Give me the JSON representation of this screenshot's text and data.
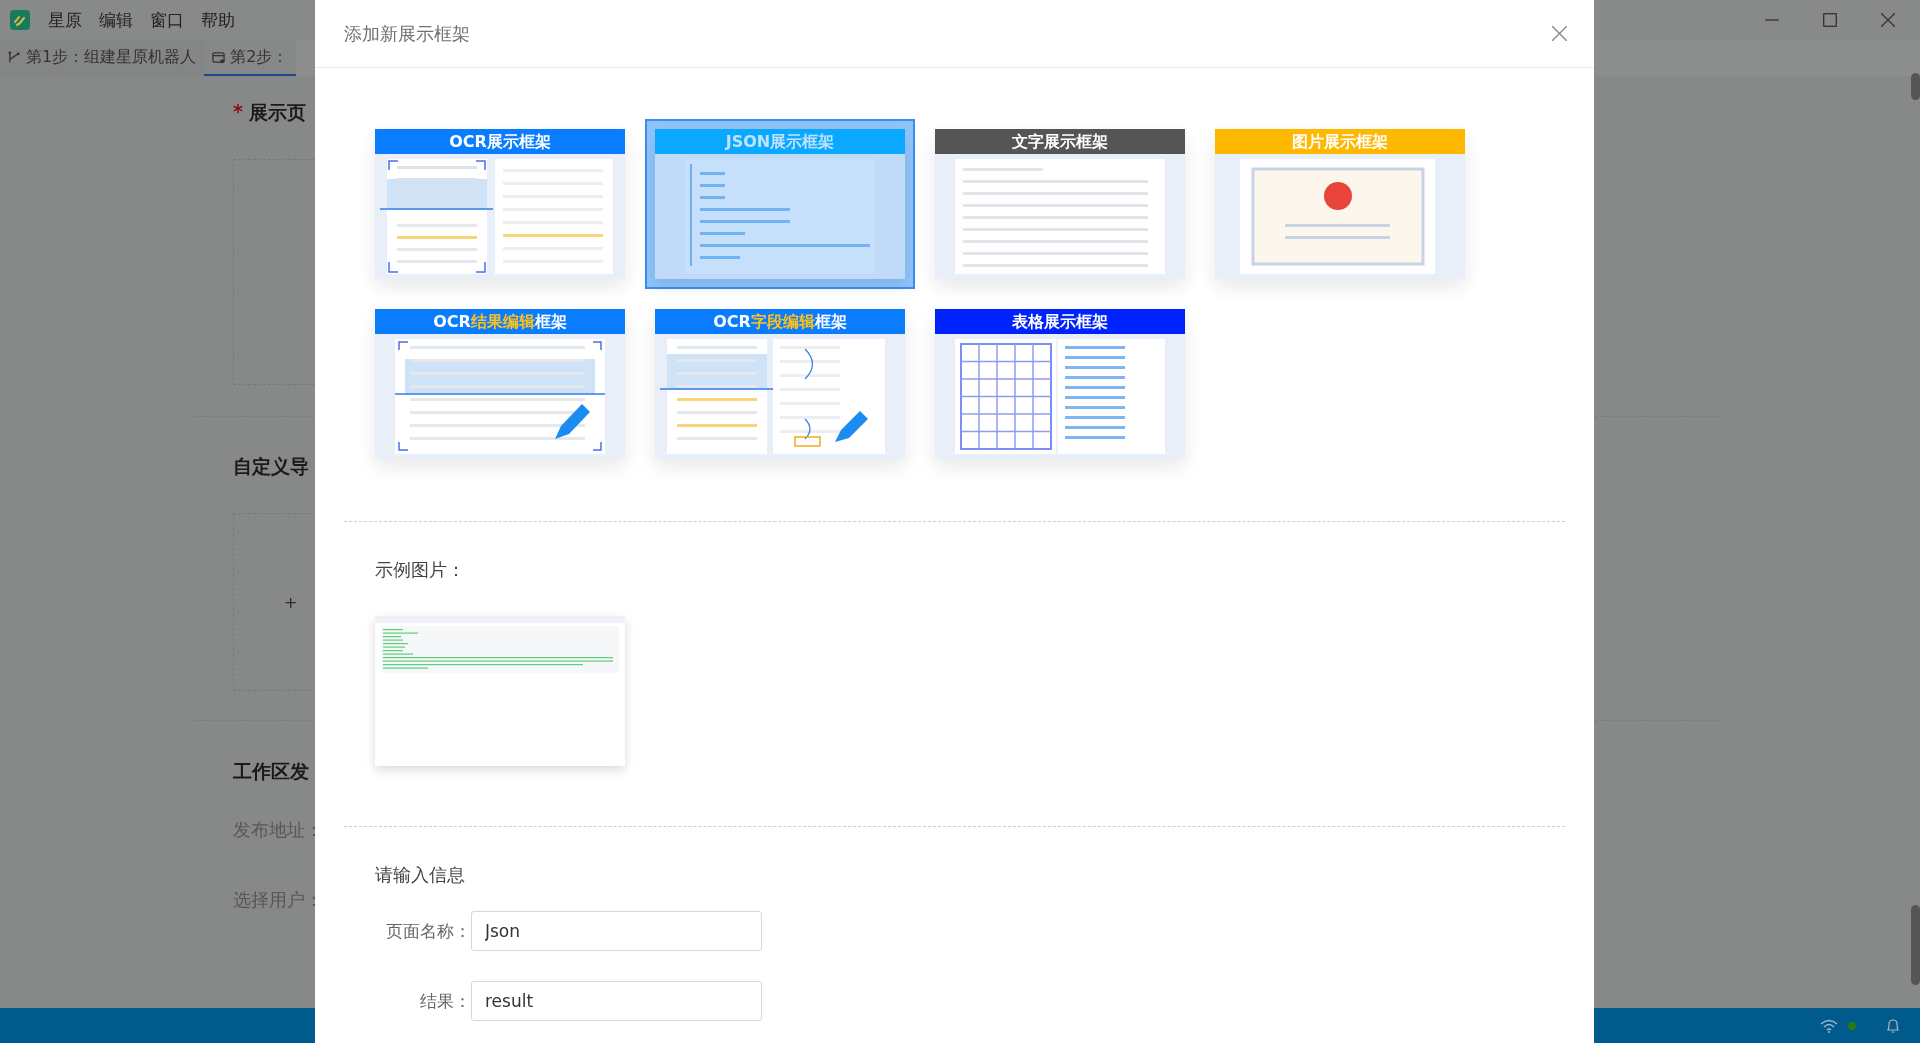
{
  "app": {
    "menu": [
      "星原",
      "编辑",
      "窗口",
      "帮助"
    ],
    "steps": [
      {
        "label": "第1步：组建星原机器人",
        "selected": false
      },
      {
        "label": "第2步：",
        "selected": true
      }
    ]
  },
  "page": {
    "required_mark": "*",
    "section_1_title": "展示页",
    "section_2_title": "自定义导",
    "add_label": "+",
    "section_3_title": "工作区发",
    "fields": [
      "发布地址：",
      "选择用户："
    ]
  },
  "dialog": {
    "title": "添加新展示框架",
    "frames": [
      {
        "kind": "ocr",
        "color": "#0a7cff",
        "selected": false,
        "title": [
          {
            "text": "OCR展示框架",
            "highlight": false
          }
        ]
      },
      {
        "kind": "json",
        "color": "#0aa8ff",
        "selected": true,
        "title": [
          {
            "text": "JSON展示框架",
            "highlight": false
          }
        ]
      },
      {
        "kind": "text",
        "color": "#555555",
        "selected": false,
        "title": [
          {
            "text": "文字展示框架",
            "highlight": false
          }
        ]
      },
      {
        "kind": "image",
        "color": "#ffb800",
        "selected": false,
        "title": [
          {
            "text": "图片展示框架",
            "highlight": false
          }
        ]
      },
      {
        "kind": "ocr_edit",
        "color": "#0a7cff",
        "selected": false,
        "title": [
          {
            "text": "OCR",
            "highlight": false
          },
          {
            "text": "结果编辑",
            "highlight": true
          },
          {
            "text": "框架",
            "highlight": false
          }
        ]
      },
      {
        "kind": "field_edit",
        "color": "#0a7cff",
        "selected": false,
        "title": [
          {
            "text": "OCR",
            "highlight": false
          },
          {
            "text": "字段编辑",
            "highlight": true
          },
          {
            "text": "框架",
            "highlight": false
          }
        ]
      },
      {
        "kind": "table",
        "color": "#0022ff",
        "selected": false,
        "title": [
          {
            "text": "表格展示框架",
            "highlight": false
          }
        ]
      }
    ],
    "sample_label": "示例图片：",
    "form": {
      "heading": "请输入信息",
      "fields": [
        {
          "label": "页面名称：",
          "value": "Json"
        },
        {
          "label": "结果：",
          "value": "result"
        }
      ]
    }
  }
}
